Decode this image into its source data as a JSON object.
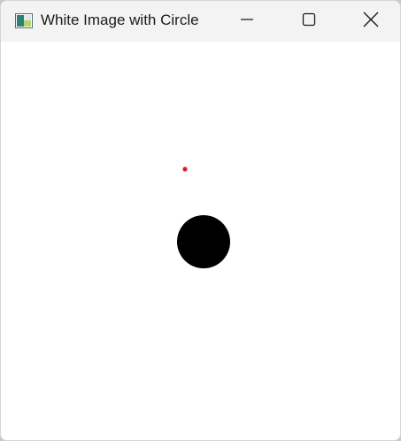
{
  "window": {
    "title": "White Image with Circle",
    "controls": {
      "minimize_icon": "minimize-icon",
      "maximize_icon": "maximize-icon",
      "close_icon": "close-icon"
    }
  },
  "canvas": {
    "background_color": "#ffffff",
    "red_dot_color": "#d42020",
    "circle_color": "#000000"
  }
}
